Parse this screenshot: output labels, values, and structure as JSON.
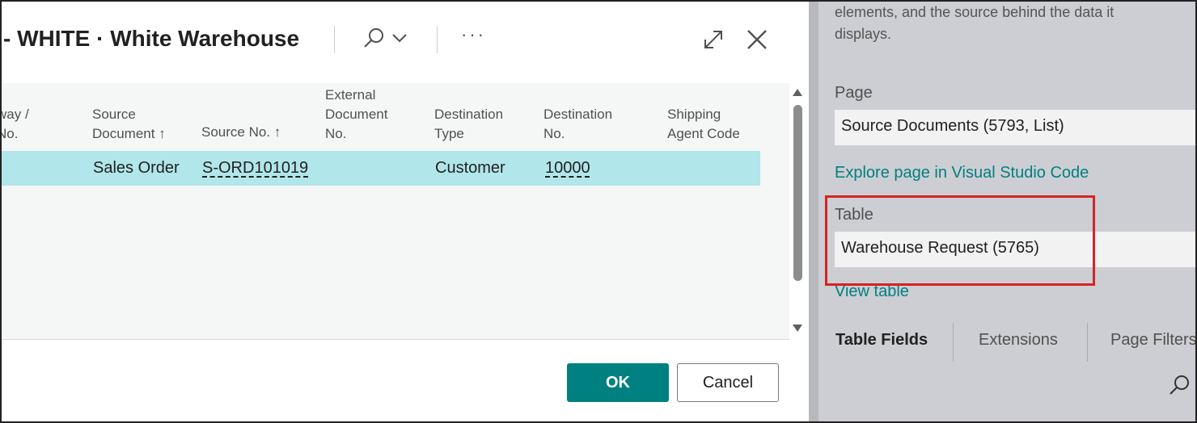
{
  "dialog": {
    "title": "- WHITE · White Warehouse",
    "more_label": "···",
    "columns": [
      {
        "label": "way /\nNo."
      },
      {
        "label": "Source\nDocument ↑"
      },
      {
        "label": "Source No. ↑"
      },
      {
        "label": "External\nDocument\nNo."
      },
      {
        "label": "Destination\nType"
      },
      {
        "label": "Destination\nNo."
      },
      {
        "label": "Shipping\nAgent Code"
      }
    ],
    "row": {
      "source_document": "Sales Order",
      "source_no": "S-ORD101019",
      "destination_type": "Customer",
      "destination_no": "10000"
    },
    "ok_label": "OK",
    "cancel_label": "Cancel"
  },
  "pane": {
    "intro": "elements, and the source behind the data it\ndisplays.",
    "page_label": "Page",
    "page_value": "Source Documents (5793, List)",
    "explore_link": "Explore page in Visual Studio Code",
    "table_label": "Table",
    "table_value": "Warehouse Request (5765)",
    "view_table_link": "View table",
    "tabs": [
      {
        "label": "Table Fields",
        "active": true
      },
      {
        "label": "Extensions",
        "active": false
      },
      {
        "label": "Page Filters",
        "active": false
      }
    ]
  },
  "colors": {
    "accent": "#008080",
    "row_selected": "#b1e6ea",
    "highlight_box": "#d32424"
  }
}
